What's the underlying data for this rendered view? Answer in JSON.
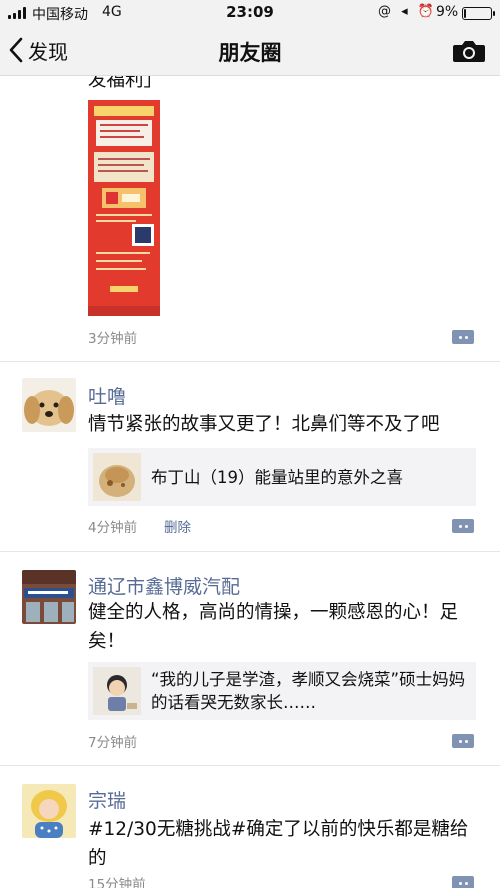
{
  "status_bar": {
    "carrier": "中国移动",
    "network": "4G",
    "time": "23:09",
    "icons": "@ ◂ ⏰",
    "battery": "9%",
    "battery_level": 0.09
  },
  "nav": {
    "back_label": "发现",
    "title": "朋友圈"
  },
  "posts": [
    {
      "partial_text": "发福利」",
      "time": "3分钟前"
    },
    {
      "name": "吐噜",
      "text": "情节紧张的故事又更了！北鼻们等不及了吧",
      "share_text": "布丁山（19）能量站里的意外之喜",
      "time": "4分钟前",
      "delete_label": "删除"
    },
    {
      "name": "通辽市鑫博威汽配",
      "text": "健全的人格，高尚的情操，一颗感恩的心！足矣！",
      "share_text": "“我的儿子是学渣，孝顺又会烧菜”硕士妈妈的话看哭无数家长……",
      "time": "7分钟前"
    },
    {
      "name": "宗瑞",
      "text": "#12/30无糖挑战#确定了以前的快乐都是糖给的",
      "time": "15分钟前"
    }
  ],
  "colors": {
    "link": "#576b95",
    "time": "#8a8a8a",
    "share_bg": "#f3f3f5",
    "poster_red": "#e23a2d"
  }
}
